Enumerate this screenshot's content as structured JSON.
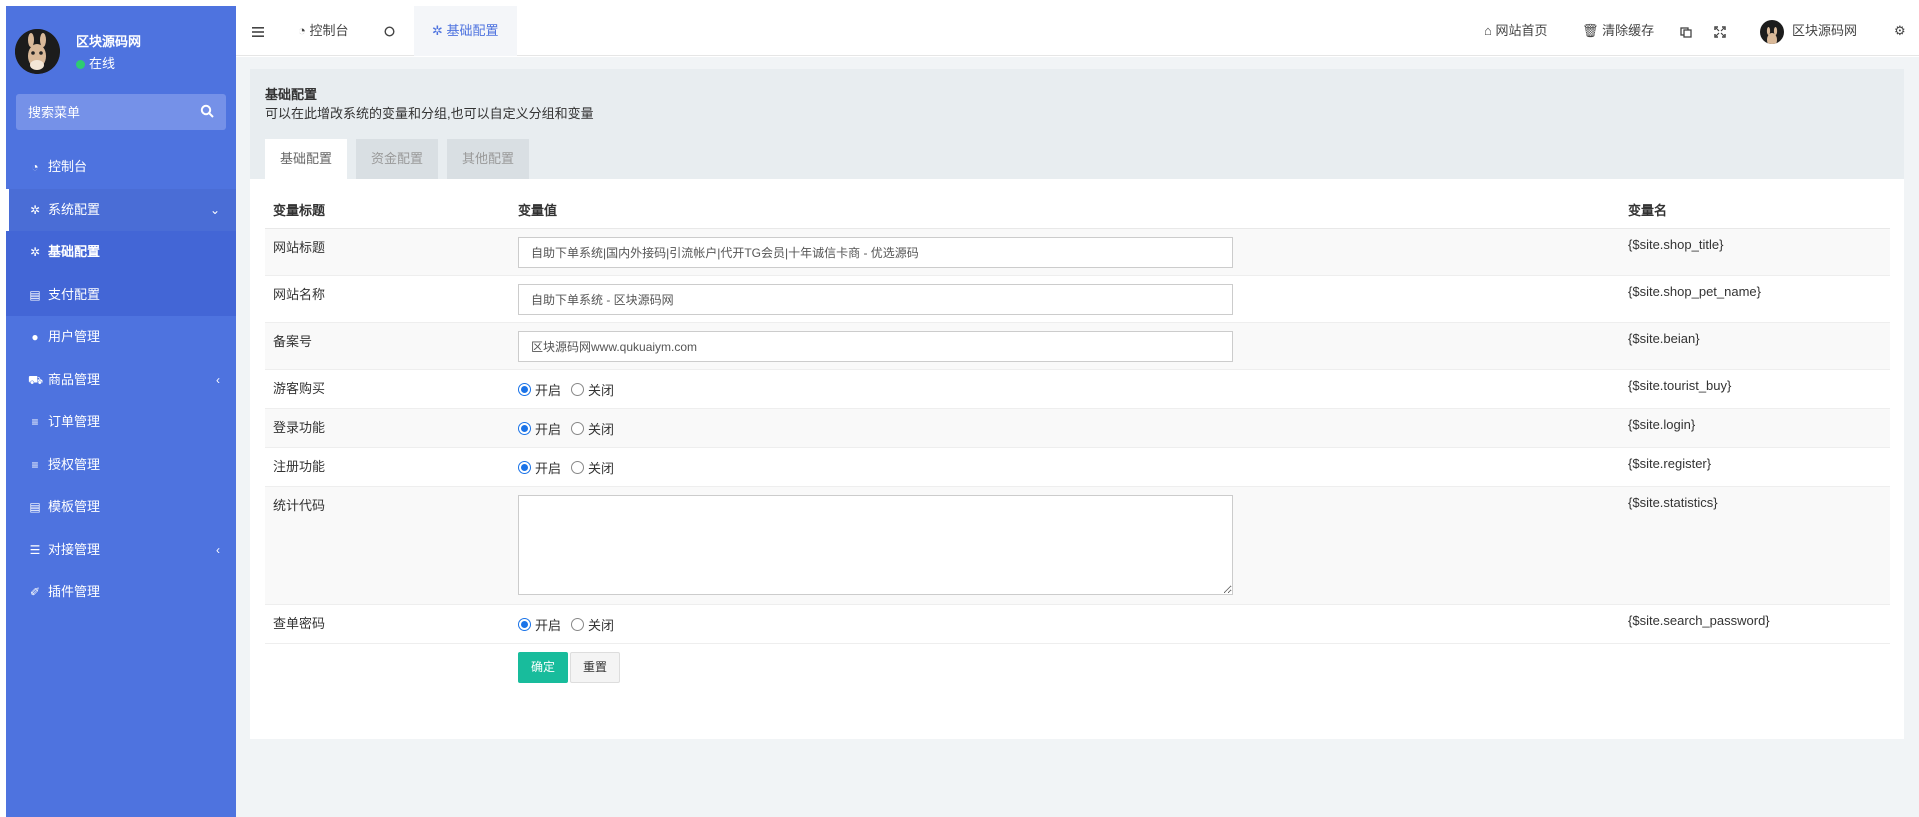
{
  "sidebar": {
    "user": {
      "name": "区块源码网",
      "status": "在线"
    },
    "search": {
      "placeholder": "搜索菜单"
    },
    "items": [
      {
        "label": "控制台",
        "icon": "dashboard-icon"
      },
      {
        "label": "系统配置",
        "icon": "gear-icon"
      },
      {
        "label": "基础配置",
        "icon": "gear-icon"
      },
      {
        "label": "支付配置",
        "icon": "table-icon"
      },
      {
        "label": "用户管理",
        "icon": "user-icon"
      },
      {
        "label": "商品管理",
        "icon": "cart-icon"
      },
      {
        "label": "订单管理",
        "icon": "list-icon"
      },
      {
        "label": "授权管理",
        "icon": "list-icon"
      },
      {
        "label": "模板管理",
        "icon": "table-icon"
      },
      {
        "label": "对接管理",
        "icon": "sliders-icon"
      },
      {
        "label": "插件管理",
        "icon": "plug-icon"
      }
    ]
  },
  "topbar": {
    "tabs": [
      {
        "label": "控制台"
      },
      {
        "label": "基础配置"
      }
    ],
    "right": {
      "home": "网站首页",
      "clear_cache": "清除缓存",
      "user": "区块源码网"
    }
  },
  "panel": {
    "title": "基础配置",
    "description": "可以在此增改系统的变量和分组,也可以自定义分组和变量",
    "tabs": [
      "基础配置",
      "资金配置",
      "其他配置"
    ]
  },
  "table": {
    "headers": {
      "title": "变量标题",
      "value": "变量值",
      "name": "变量名"
    },
    "rows": [
      {
        "title": "网站标题",
        "value": "自助下单系统|国内外接码|引流帐户|代开TG会员|十年诚信卡商 - 优选源码",
        "name": "{$site.shop_title}"
      },
      {
        "title": "网站名称",
        "value": "自助下单系统 - 区块源码网",
        "name": "{$site.shop_pet_name}"
      },
      {
        "title": "备案号",
        "value": "区块源码网www.qukuaiym.com",
        "name": "{$site.beian}"
      },
      {
        "title": "游客购买",
        "name": "{$site.tourist_buy}"
      },
      {
        "title": "登录功能",
        "name": "{$site.login}"
      },
      {
        "title": "注册功能",
        "name": "{$site.register}"
      },
      {
        "title": "统计代码",
        "name": "{$site.statistics}"
      },
      {
        "title": "查单密码",
        "name": "{$site.search_password}"
      }
    ],
    "radio": {
      "on": "开启",
      "off": "关闭"
    }
  },
  "buttons": {
    "ok": "确定",
    "reset": "重置"
  }
}
